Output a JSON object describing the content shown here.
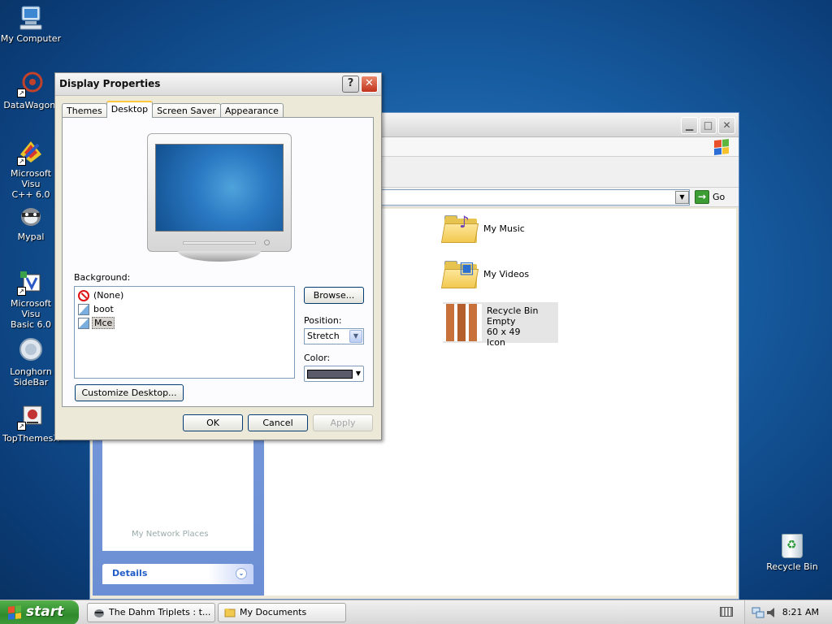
{
  "desktop": {
    "icons": [
      {
        "label": "My Computer",
        "icon": "my-computer-icon"
      },
      {
        "label": "DataWagon.",
        "icon": "datawagon-icon"
      },
      {
        "label": "Microsoft Visu\nC++ 6.0",
        "icon": "visual-cpp-icon"
      },
      {
        "label": "Mypal",
        "icon": "mypal-icon"
      },
      {
        "label": "Microsoft Visu\nBasic 6.0",
        "icon": "visual-basic-icon"
      },
      {
        "label": "Longhorn\nSideBar",
        "icon": "longhorn-sidebar-icon"
      },
      {
        "label": "TopThemesX",
        "icon": "topthemes-icon"
      }
    ],
    "recycle_bin": {
      "label": "Recycle Bin"
    }
  },
  "explorer": {
    "go_label": "Go",
    "items": [
      {
        "label": "My Music"
      },
      {
        "label": "My Videos"
      }
    ],
    "selected_file": {
      "name": "Recycle Bin Empty",
      "dimensions": "60 x 49",
      "type": "Icon"
    },
    "network_places_partial": "My Network Places",
    "details_label": "Details"
  },
  "dialog": {
    "title": "Display Properties",
    "help_label": "?",
    "tabs": [
      {
        "label": "Themes",
        "active": false
      },
      {
        "label": "Desktop",
        "active": true
      },
      {
        "label": "Screen Saver",
        "active": false
      },
      {
        "label": "Appearance",
        "active": false
      }
    ],
    "background_label": "Background:",
    "backgrounds": [
      {
        "name": "(None)",
        "icon": "none-icon"
      },
      {
        "name": "boot",
        "icon": "bitmap-icon"
      },
      {
        "name": "Mce",
        "icon": "bitmap-icon",
        "selected": true
      }
    ],
    "browse_label": "Browse...",
    "position_label": "Position:",
    "position_value": "Stretch",
    "color_label": "Color:",
    "color_value": "#5a5a6a",
    "customize_label": "Customize Desktop...",
    "ok_label": "OK",
    "cancel_label": "Cancel",
    "apply_label": "Apply"
  },
  "taskbar": {
    "start_label": "start",
    "tasks": [
      {
        "label": "The Dahm Triplets : t..."
      },
      {
        "label": "My Documents"
      }
    ],
    "clock": "8:21 AM"
  },
  "colors": {
    "start_green": "#3f9b3a",
    "tab_highlight": "#ffc83c",
    "close_red": "#c1331a"
  }
}
